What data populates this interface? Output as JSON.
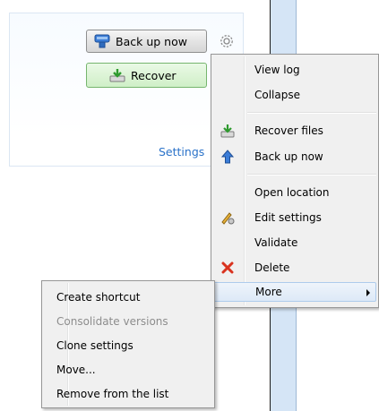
{
  "panel": {
    "backup_button": "Back up now",
    "recover_button": "Recover",
    "settings_link": "Settings"
  },
  "context_menu": {
    "items": [
      {
        "label": "View log"
      },
      {
        "label": "Collapse"
      },
      {
        "label": "Recover files",
        "icon": "recover-icon"
      },
      {
        "label": "Back up now",
        "icon": "backup-icon"
      },
      {
        "label": "Open location"
      },
      {
        "label": "Edit settings",
        "icon": "edit-settings-icon"
      },
      {
        "label": "Validate"
      },
      {
        "label": "Delete",
        "icon": "delete-icon"
      },
      {
        "label": "More",
        "has_submenu": true,
        "selected": true
      }
    ]
  },
  "submenu": {
    "items": [
      {
        "label": "Create shortcut"
      },
      {
        "label": "Consolidate versions",
        "disabled": true
      },
      {
        "label": "Clone settings"
      },
      {
        "label": "Move..."
      },
      {
        "label": "Remove from the list"
      }
    ]
  },
  "colors": {
    "link": "#2a72c9",
    "recover_button_bg": "#cfefc7",
    "menu_bg": "#f0f0f0",
    "delete_icon": "#d9331f"
  }
}
